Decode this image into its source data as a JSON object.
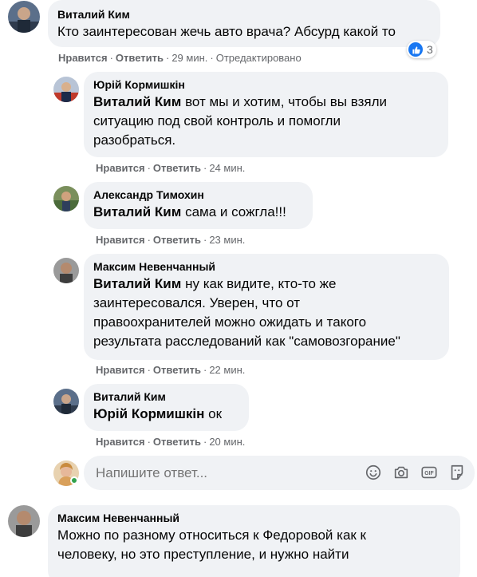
{
  "comments": [
    {
      "author": "Виталий Ким",
      "mention": "",
      "text": "Кто заинтересован жечь авто врача? Абсурд какой то",
      "like": "Нравится",
      "reply": "Ответить",
      "time": "29 мин.",
      "edited": "Отредактировано",
      "reactions": "3"
    },
    {
      "author": "Юрій Кормишкін",
      "mention": "Виталий Ким",
      "lines": [
        "вот мы и хотим, чтобы вы взяли",
        "ситуацию под свой контроль и помогли",
        "разобраться."
      ],
      "like": "Нравится",
      "reply": "Ответить",
      "time": "24 мин."
    },
    {
      "author": "Александр Тимохин",
      "mention": "Виталий Ким",
      "text": "сама и сожгла!!!",
      "like": "Нравится",
      "reply": "Ответить",
      "time": "23 мин."
    },
    {
      "author": "Максим Невенчанный",
      "mention": "Виталий Ким",
      "lines": [
        "ну как видите, кто-то же",
        "заинтересовался. Уверен, что от",
        "правоохранителей можно ожидать и такого",
        "результата расследований как \"самовозгорание\""
      ],
      "like": "Нравится",
      "reply": "Ответить",
      "time": "22 мин."
    },
    {
      "author": "Виталий Ким",
      "mention": "Юрій Кормишкін",
      "text": "ок",
      "like": "Нравится",
      "reply": "Ответить",
      "time": "20 мин."
    },
    {
      "author": "Максим Невенчанный",
      "mention": "",
      "lines": [
        "Можно по разному относиться к Федоровой как к",
        "человеку, но это преступление, и нужно найти"
      ]
    }
  ],
  "reply_box": {
    "placeholder": "Напишите ответ..."
  },
  "icons": {
    "emoji": "emoji-icon",
    "camera": "camera-icon",
    "gif": "gif-icon",
    "sticker": "sticker-icon",
    "like": "like-icon"
  },
  "colors": {
    "bubble": "#f0f2f5",
    "meta": "#65676b",
    "like_blue": "#1877f2",
    "online": "#31a24c"
  }
}
